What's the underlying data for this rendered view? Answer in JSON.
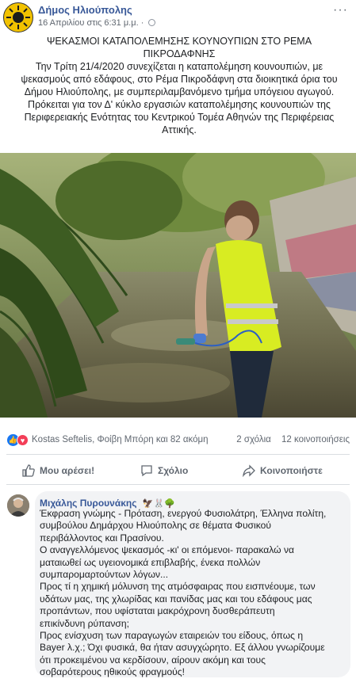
{
  "post": {
    "page_name": "Δήμος Ηλιούπολης",
    "timestamp": "16 Απριλίου στις 6:31 μ.μ.",
    "dot": "·",
    "menu": "···",
    "text_lines": [
      "ΨΕΚΑΣΜΟΙ ΚΑΤΑΠΟΛΕΜΗΣΗΣ ΚΟΥΝΟΥΠΙΩΝ ΣΤΟ ΡΕΜΑ",
      "ΠΙΚΡΟΔΑΦΝΗΣ",
      "Την Τρίτη 21/4/2020 συνεχίζεται η καταπολέμηση κουνουπιών, με",
      "ψεκασμούς από εδάφους, στο Ρέμα Πικροδάφνη στα διοικητικά όρια του",
      "Δήμου Ηλιούπολης, με συμπεριλαμβανόμενο τμήμα υπόγειου αγωγού.",
      "Πρόκειται για τον Δ' κύκλο εργασιών καταπολέμησης κουνουπιών της",
      "Περιφερειακής Ενότητας του Κεντρικού Τομέα Αθηνών της Περιφέρειας",
      "Αττικής."
    ]
  },
  "reactions": {
    "names": "Kostas Seftelis, Φοίβη Μπόρη και 82 ακόμη",
    "comments": "2 σχόλια",
    "shares": "12 κοινοποιήσεις"
  },
  "actions": {
    "like": "Μου αρέσει!",
    "comment": "Σχόλιο",
    "share": "Κοινοποιήστε"
  },
  "comment": {
    "author": "Μιχάλης Πυρουνάκης",
    "author_emoji": "🦅🐰🌳",
    "lines": [
      "Έκφραση γνώμης - Πρόταση, ενεργού Φυσιολάτρη, Έλληνα πολίτη,",
      "συμβούλου Δημάρχου Ηλιούπολης σε θέματα Φυσικού",
      "περιβάλλοντος και Πρασίνου.",
      "Ο αναγγελλόμενος ψεκασμός -κι' οι επόμενοι- παρακαλώ να",
      "ματαιωθεί ως υγειονομικά επιβλαβής, ένεκα πολλών",
      "συμπαρομαρτούντων λόγων...",
      "Προς τί η χημική μόλυνση της ατμόσφαιρας που εισπνέουμε, των",
      "υδάτων μας, της χλωρίδας και πανίδας μας και του εδάφους μας",
      "προπάντων, που υφίσταται μακρόχρονη δυσθεράπευτη",
      "επικίνδυνη ρύπανση;",
      "Προς ενίσχυση των παραγωγών εταιρειών του είδους, όπως η",
      "Bayer λ.χ.; Όχι φυσικά, θα ήταν ασυγχώρητο. Εξ άλλου γνωρίζουμε",
      "ότι προκειμένου να κερδίσουν, αίρουν ακόμη και τους",
      "σοβαρότερους ηθικούς φραγμούς!"
    ]
  }
}
